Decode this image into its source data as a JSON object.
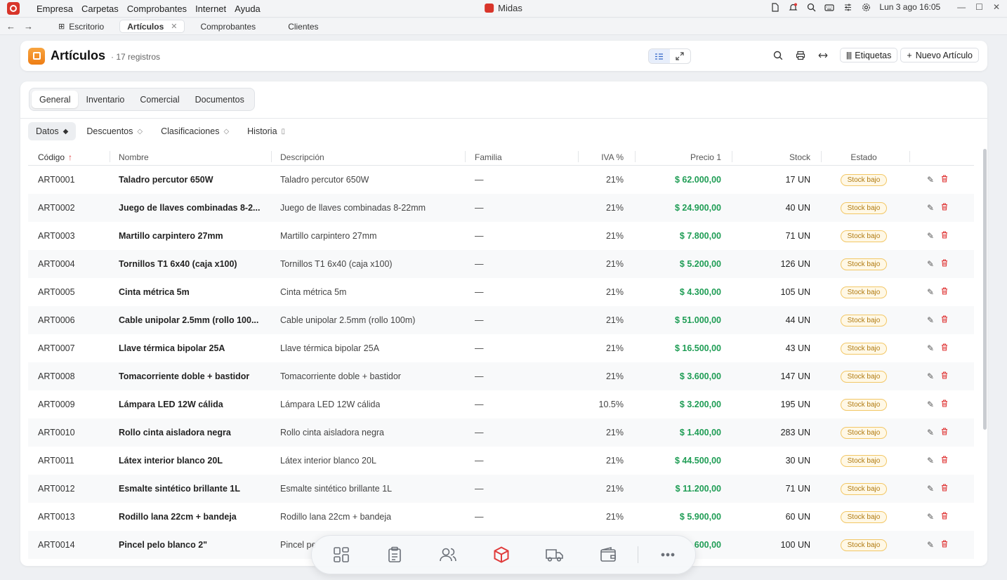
{
  "menubar": {
    "menus": [
      "Empresa",
      "Carpetas",
      "Comprobantes",
      "Internet",
      "Ayuda"
    ],
    "window_title": "Midas",
    "clock": "Lun 3 ago  16:05"
  },
  "tabs": [
    {
      "label": "Escritorio",
      "active": false
    },
    {
      "label": "Artículos",
      "active": true
    },
    {
      "label": "Comprobantes",
      "active": false
    },
    {
      "label": "Clientes",
      "active": false
    }
  ],
  "header": {
    "title": "Artículos",
    "count": "· 17 registros",
    "etiquetas_label": "Etiquetas",
    "nuevo_label": "Nuevo Artículo"
  },
  "segment_tabs": [
    "General",
    "Inventario",
    "Comercial",
    "Documentos"
  ],
  "sub_tabs": [
    "Datos",
    "Descuentos",
    "Clasificaciones",
    "Historia"
  ],
  "table": {
    "columns": {
      "codigo": "Código",
      "nombre": "Nombre",
      "descripcion": "Descripción",
      "familia": "Familia",
      "iva": "IVA %",
      "precio": "Precio 1",
      "stock": "Stock",
      "estado": "Estado"
    },
    "rows": [
      {
        "codigo": "ART0001",
        "nombre": "Taladro percutor 650W",
        "descripcion": "Taladro percutor 650W",
        "familia": "—",
        "iva": "21%",
        "precio": "$ 62.000,00",
        "stock": "17 UN",
        "estado": "Stock bajo"
      },
      {
        "codigo": "ART0002",
        "nombre": "Juego de llaves combinadas 8-2...",
        "descripcion": "Juego de llaves combinadas 8-22mm",
        "familia": "—",
        "iva": "21%",
        "precio": "$ 24.900,00",
        "stock": "40 UN",
        "estado": "Stock bajo"
      },
      {
        "codigo": "ART0003",
        "nombre": "Martillo carpintero 27mm",
        "descripcion": "Martillo carpintero 27mm",
        "familia": "—",
        "iva": "21%",
        "precio": "$ 7.800,00",
        "stock": "71 UN",
        "estado": "Stock bajo"
      },
      {
        "codigo": "ART0004",
        "nombre": "Tornillos T1 6x40 (caja x100)",
        "descripcion": "Tornillos T1 6x40 (caja x100)",
        "familia": "—",
        "iva": "21%",
        "precio": "$ 5.200,00",
        "stock": "126 UN",
        "estado": "Stock bajo"
      },
      {
        "codigo": "ART0005",
        "nombre": "Cinta métrica 5m",
        "descripcion": "Cinta métrica 5m",
        "familia": "—",
        "iva": "21%",
        "precio": "$ 4.300,00",
        "stock": "105 UN",
        "estado": "Stock bajo"
      },
      {
        "codigo": "ART0006",
        "nombre": "Cable unipolar 2.5mm (rollo 100...",
        "descripcion": "Cable unipolar 2.5mm (rollo 100m)",
        "familia": "—",
        "iva": "21%",
        "precio": "$ 51.000,00",
        "stock": "44 UN",
        "estado": "Stock bajo"
      },
      {
        "codigo": "ART0007",
        "nombre": "Llave térmica bipolar 25A",
        "descripcion": "Llave térmica bipolar 25A",
        "familia": "—",
        "iva": "21%",
        "precio": "$ 16.500,00",
        "stock": "43 UN",
        "estado": "Stock bajo"
      },
      {
        "codigo": "ART0008",
        "nombre": "Tomacorriente doble + bastidor",
        "descripcion": "Tomacorriente doble + bastidor",
        "familia": "—",
        "iva": "21%",
        "precio": "$ 3.600,00",
        "stock": "147 UN",
        "estado": "Stock bajo"
      },
      {
        "codigo": "ART0009",
        "nombre": "Lámpara LED 12W cálida",
        "descripcion": "Lámpara LED 12W cálida",
        "familia": "—",
        "iva": "10.5%",
        "precio": "$ 3.200,00",
        "stock": "195 UN",
        "estado": "Stock bajo"
      },
      {
        "codigo": "ART0010",
        "nombre": "Rollo cinta aisladora negra",
        "descripcion": "Rollo cinta aisladora negra",
        "familia": "—",
        "iva": "21%",
        "precio": "$ 1.400,00",
        "stock": "283 UN",
        "estado": "Stock bajo"
      },
      {
        "codigo": "ART0011",
        "nombre": "Látex interior blanco 20L",
        "descripcion": "Látex interior blanco 20L",
        "familia": "—",
        "iva": "21%",
        "precio": "$ 44.500,00",
        "stock": "30 UN",
        "estado": "Stock bajo"
      },
      {
        "codigo": "ART0012",
        "nombre": "Esmalte sintético brillante 1L",
        "descripcion": "Esmalte sintético brillante 1L",
        "familia": "—",
        "iva": "21%",
        "precio": "$ 11.200,00",
        "stock": "71 UN",
        "estado": "Stock bajo"
      },
      {
        "codigo": "ART0013",
        "nombre": "Rodillo lana 22cm + bandeja",
        "descripcion": "Rodillo lana 22cm + bandeja",
        "familia": "—",
        "iva": "21%",
        "precio": "$ 5.900,00",
        "stock": "60 UN",
        "estado": "Stock bajo"
      },
      {
        "codigo": "ART0014",
        "nombre": "Pincel pelo blanco 2\"",
        "descripcion": "Pincel pe",
        "familia": "",
        "iva": "",
        "precio": "600,00",
        "stock": "100 UN",
        "estado": "Stock bajo"
      }
    ]
  },
  "dock": {
    "items": [
      "grid-icon",
      "clipboard-icon",
      "users-icon",
      "box-icon",
      "truck-icon",
      "wallet-icon",
      "more-icon"
    ],
    "active": "box-icon"
  },
  "colors": {
    "accent_red": "#e03b3b",
    "price_green": "#1f9d55",
    "badge_amber": "#b07a10",
    "header_icon_orange": "#ee7d14"
  }
}
